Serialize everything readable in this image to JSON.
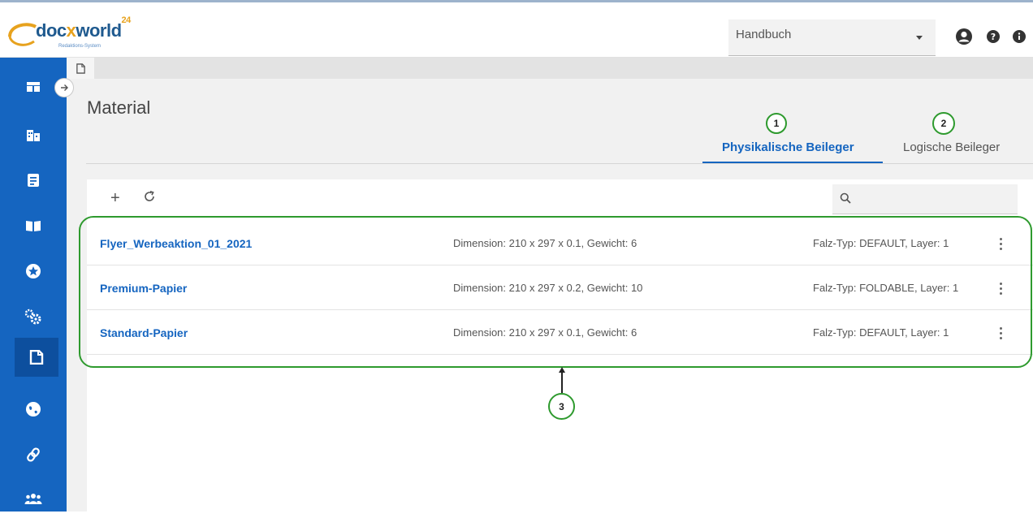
{
  "app": {
    "logo_brand_a": "doc",
    "logo_brand_x": "x",
    "logo_brand_b": "world",
    "logo_sup": "24",
    "logo_sub": "Redaktions-System"
  },
  "header": {
    "select_value": "Handbuch",
    "icons": [
      "account-circle-icon",
      "help-icon",
      "info-icon"
    ]
  },
  "sidebar": {
    "items": [
      "dashboard-icon",
      "building-icon",
      "document-icon",
      "book-icon",
      "star-icon",
      "settings-icon",
      "material-icon",
      "globe-icon",
      "link-icon",
      "users-icon"
    ],
    "active": "material-icon",
    "accent": "#1565c0"
  },
  "page": {
    "title": "Material",
    "tabs": [
      {
        "label": "Physikalische Beileger",
        "active": true
      },
      {
        "label": "Logische Beileger",
        "active": false
      }
    ]
  },
  "toolbar": {
    "add": "+",
    "refresh": "⟳"
  },
  "rows": [
    {
      "name": "Flyer_Werbeaktion_01_2021",
      "dimension": "Dimension: 210 x 297 x 0.1, Gewicht: 6",
      "falz": "Falz-Typ: DEFAULT, Layer: 1"
    },
    {
      "name": "Premium-Papier",
      "dimension": "Dimension: 210 x 297 x 0.2, Gewicht: 10",
      "falz": "Falz-Typ: FOLDABLE, Layer: 1"
    },
    {
      "name": "Standard-Papier",
      "dimension": "Dimension: 210 x 297 x 0.1, Gewicht: 6",
      "falz": "Falz-Typ: DEFAULT, Layer: 1"
    }
  ],
  "annotations": [
    "1",
    "2",
    "3"
  ],
  "colors": {
    "annotation": "#2e9a2e",
    "brand_orange": "#e7a21e"
  }
}
